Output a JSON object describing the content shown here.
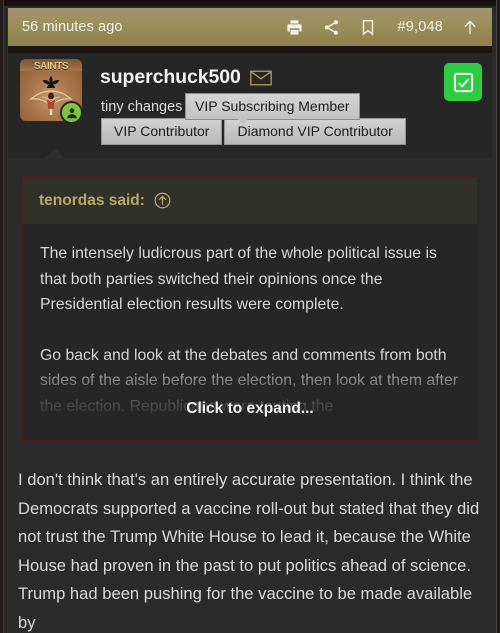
{
  "theme": {
    "accent_gold": "#9c8e5c",
    "page_bg": "#2b2b2b",
    "quote_border": "#4a1c1c",
    "author_gold": "#b8a96a",
    "online_green": "#7dc63f",
    "check_green": "#2ecc40"
  },
  "meta_bar": {
    "timestamp": "56 minutes ago",
    "post_number": "#9,048",
    "actions": [
      {
        "name": "print-icon",
        "label": "Print"
      },
      {
        "name": "share-icon",
        "label": "Share"
      },
      {
        "name": "bookmark-icon",
        "label": "Bookmark"
      },
      {
        "name": "scroll-to-top-icon",
        "label": "Top"
      }
    ]
  },
  "user": {
    "username": "superchuck500",
    "user_title": "tiny changes",
    "avatar": {
      "name": "user-avatar",
      "word_mark": "SAINTS",
      "online_status": "online"
    },
    "message_icon": "envelope-icon",
    "tooltip": "VIP Subscribing Member",
    "badges": [
      "VIP Contributor",
      "Diamond VIP Contributor"
    ],
    "select_checkbox": {
      "name": "post-select-checkbox",
      "state": "checked"
    }
  },
  "quote": {
    "author_label": "tenordas said:",
    "jump_icon": "jump-to-post-icon",
    "paragraphs": [
      "The intensely ludicrous part of the whole political issue is that both parties switched their opinions once the Presidential election results were complete.",
      "Go back and look at the debates and comments from both sides of the aisle before the election, then look at them after the election. Republicans were touting the"
    ],
    "expand_label": "Click to expand..."
  },
  "post": {
    "paragraphs": [
      "I don't think that's an entirely accurate presentation. I think the Democrats supported a vaccine roll-out but stated that they did not trust the Trump White House to lead it, because the White House had proven in the past to put politics ahead of science. Trump had been pushing for the vaccine to be made available by"
    ]
  }
}
